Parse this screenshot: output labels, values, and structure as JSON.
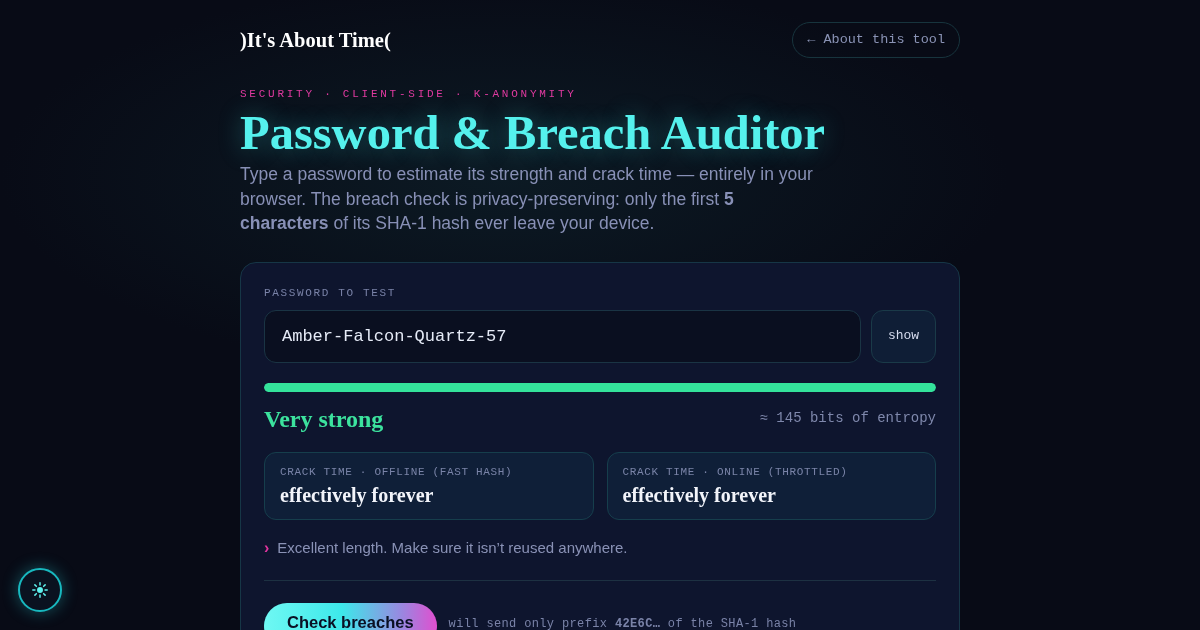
{
  "header": {
    "logo": ")It's About Time(",
    "about_link": "← About this tool"
  },
  "hero": {
    "eyebrow": "SECURITY · CLIENT-SIDE · K-ANONYMITY",
    "title": "Password & Breach Auditor",
    "intro": "Type a password to estimate its strength and crack time — entirely in your browser. The breach check is privacy-preserving: only the first **5 characters** of its SHA-1 hash ever leave your device."
  },
  "auditor": {
    "field_label": "PASSWORD TO TEST",
    "password": {
      "value": "Amber-Falcon-Quartz-57"
    },
    "toggle_button": "show",
    "strength": {
      "level": 1,
      "label": "Very strong",
      "entropy": "≈ 145 bits of entropy"
    },
    "crack_times": [
      {
        "label": "CRACK TIME · OFFLINE (FAST HASH)",
        "value": "effectively forever"
      },
      {
        "label": "CRACK TIME · ONLINE (THROTTLED)",
        "value": "effectively forever"
      }
    ],
    "tip": {
      "marker": "›",
      "text": "Excellent length. Make sure it isn’t reused anywhere."
    },
    "check_button": "Check breaches",
    "prefix_note": "will send only prefix **42E6C…** of the SHA-1 hash"
  }
}
